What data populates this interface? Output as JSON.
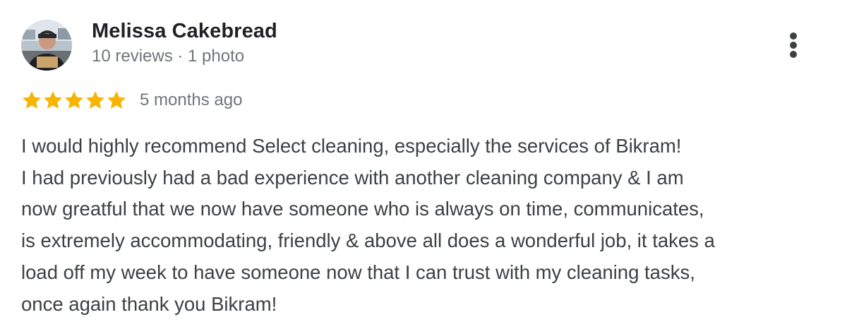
{
  "reviewer": {
    "name": "Melissa Cakebread",
    "meta": "10 reviews · 1 photo"
  },
  "rating": {
    "stars": 5,
    "max_stars": 5,
    "star_color": "#f6b500",
    "date": "5 months ago"
  },
  "review": {
    "lines": [
      "I would highly recommend Select cleaning, especially the services of Bikram!",
      "I had previously had a bad experience with another cleaning company & I am",
      "now greatful that we now have someone who is always on time, communicates,",
      "is extremely accommodating, friendly & above all does a wonderful job, it takes a",
      "load off my week to have someone now that I can trust with my cleaning tasks,",
      "once again thank you Bikram!"
    ]
  },
  "icons": {
    "more": "more-vert-icon",
    "star": "star-icon",
    "avatar": "user-avatar"
  },
  "colors": {
    "name": "#202124",
    "meta": "#70757a",
    "body": "#3c4043",
    "background": "#ffffff"
  }
}
